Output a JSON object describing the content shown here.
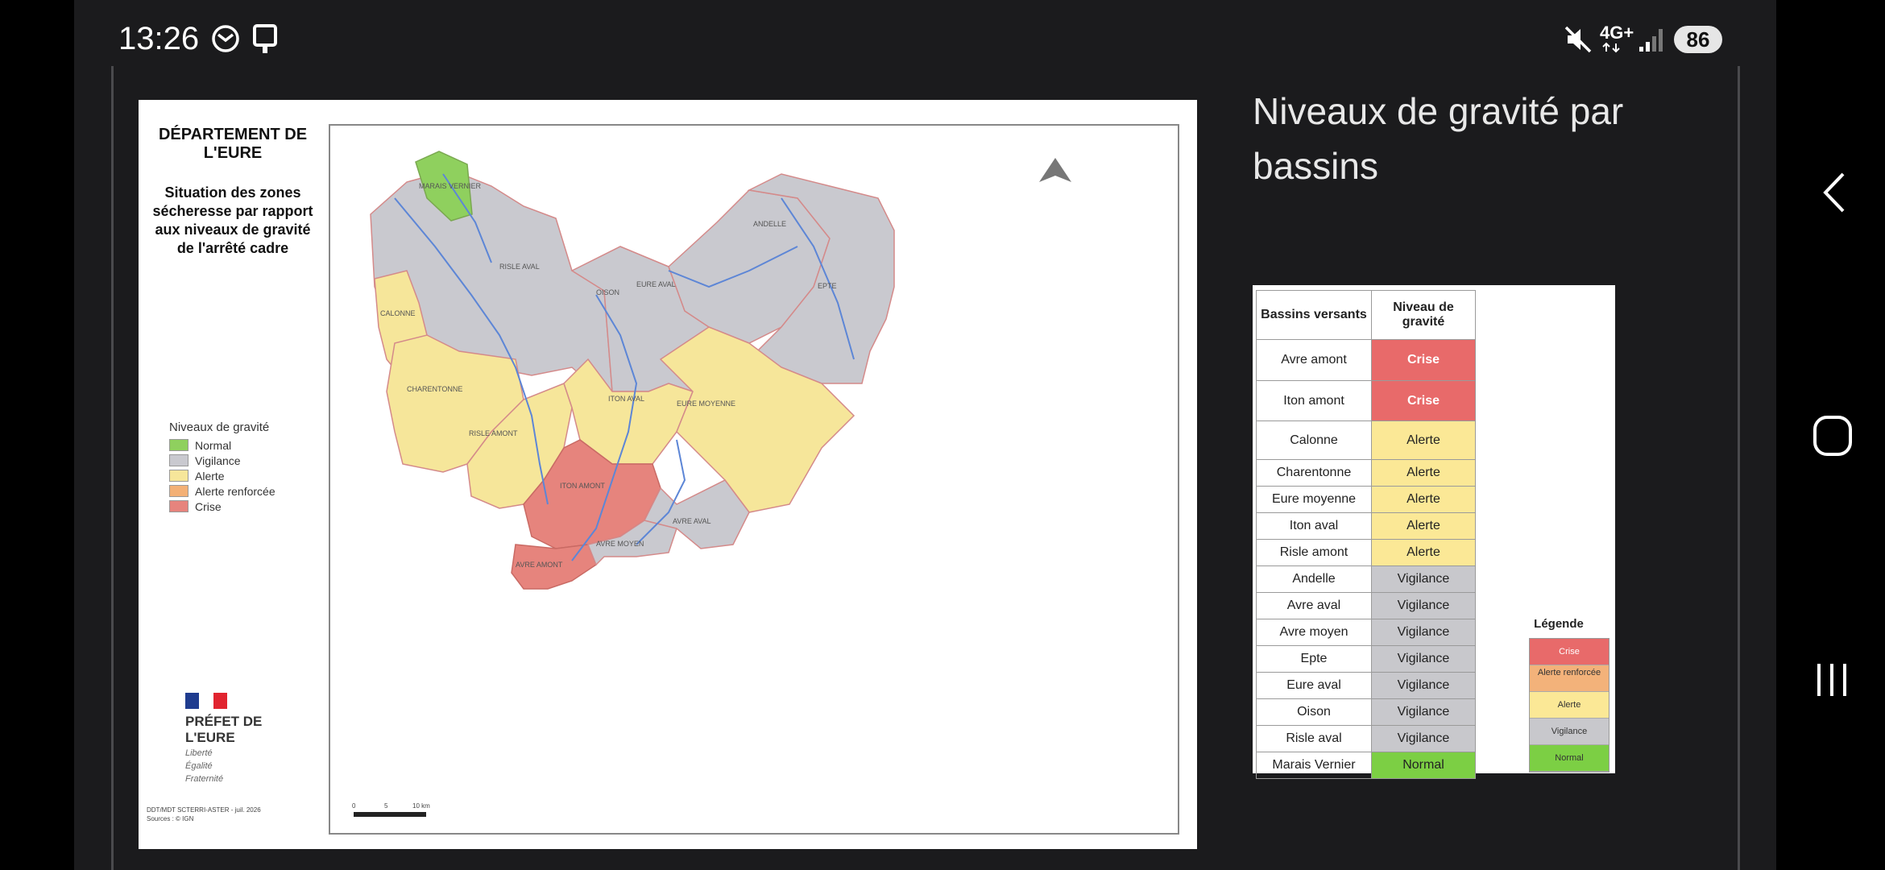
{
  "status_bar": {
    "time": "13:26",
    "network": "4G+",
    "battery": "86"
  },
  "map": {
    "title": "DÉPARTEMENT DE L'EURE",
    "subtitle": "Situation des zones sécheresse par rapport aux niveaux de gravité de l'arrêté cadre",
    "legend_title": "Niveaux de gravité",
    "legend": [
      {
        "label": "Normal",
        "color": "#8fd05e"
      },
      {
        "label": "Vigilance",
        "color": "#c9c9cf"
      },
      {
        "label": "Alerte",
        "color": "#f6e69a"
      },
      {
        "label": "Alerte renforcée",
        "color": "#f3b076"
      },
      {
        "label": "Crise",
        "color": "#e6847d"
      }
    ],
    "prefet": "PRÉFET DE L'EURE",
    "devise": [
      "Liberté",
      "Égalité",
      "Fraternité"
    ],
    "credit": [
      "DDT/MDT SCTERRI-ASTER - juil. 2026",
      "Sources : © IGN"
    ],
    "scale_labels": [
      "0",
      "5",
      "10 km"
    ],
    "regions": {
      "marais_vernier": "MARAIS VERNIER",
      "risle_aval": "RISLE AVAL",
      "calonne": "CALONNE",
      "oison": "OISON",
      "eure_aval": "EURE AVAL",
      "andelle": "ANDELLE",
      "epte": "EPTE",
      "charentonne": "CHARENTONNE",
      "risle_amont": "RISLE AMONT",
      "iton_aval": "ITON AVAL",
      "eure_moyenne": "EURE MOYENNE",
      "iton_amont": "ITON AMONT",
      "avre_aval": "AVRE AVAL",
      "avre_moyen": "AVRE MOYEN",
      "avre_amont": "AVRE AMONT"
    },
    "colors": {
      "crise": "#e6847d",
      "alerte": "#f6e69a",
      "vigilance": "#c9c9cf",
      "normal": "#8fd05e",
      "river": "#5d86d6"
    }
  },
  "heading": "Niveaux de gravité par bassins",
  "table": {
    "headers": [
      "Bassins versants",
      "Niveau de gravité"
    ],
    "rows": [
      {
        "bassin": "Avre amont",
        "niveau": "Crise",
        "color": "#e86a6a"
      },
      {
        "bassin": "Iton amont",
        "niveau": "Crise",
        "color": "#e86a6a"
      },
      {
        "bassin": "Calonne",
        "niveau": "Alerte",
        "color": "#fbe896"
      },
      {
        "bassin": "Charentonne",
        "niveau": "Alerte",
        "color": "#fbe896"
      },
      {
        "bassin": "Eure moyenne",
        "niveau": "Alerte",
        "color": "#fbe896"
      },
      {
        "bassin": "Iton aval",
        "niveau": "Alerte",
        "color": "#fbe896"
      },
      {
        "bassin": "Risle amont",
        "niveau": "Alerte",
        "color": "#fbe896"
      },
      {
        "bassin": "Andelle",
        "niveau": "Vigilance",
        "color": "#c8c8cc"
      },
      {
        "bassin": "Avre aval",
        "niveau": "Vigilance",
        "color": "#c8c8cc"
      },
      {
        "bassin": "Avre moyen",
        "niveau": "Vigilance",
        "color": "#c8c8cc"
      },
      {
        "bassin": "Epte",
        "niveau": "Vigilance",
        "color": "#c8c8cc"
      },
      {
        "bassin": "Eure aval",
        "niveau": "Vigilance",
        "color": "#c8c8cc"
      },
      {
        "bassin": "Oison",
        "niveau": "Vigilance",
        "color": "#c8c8cc"
      },
      {
        "bassin": "Risle aval",
        "niveau": "Vigilance",
        "color": "#c8c8cc"
      },
      {
        "bassin": "Marais Vernier",
        "niveau": "Normal",
        "color": "#7ccf44"
      }
    ],
    "legend_title": "Légende",
    "legend": [
      {
        "label": "Crise",
        "color": "#e86a6a"
      },
      {
        "label": "Alerte renforcée",
        "color": "#f3b27a"
      },
      {
        "label": "Alerte",
        "color": "#fbe896"
      },
      {
        "label": "Vigilance",
        "color": "#c8c8cc"
      },
      {
        "label": "Normal",
        "color": "#7ccf44"
      }
    ]
  }
}
